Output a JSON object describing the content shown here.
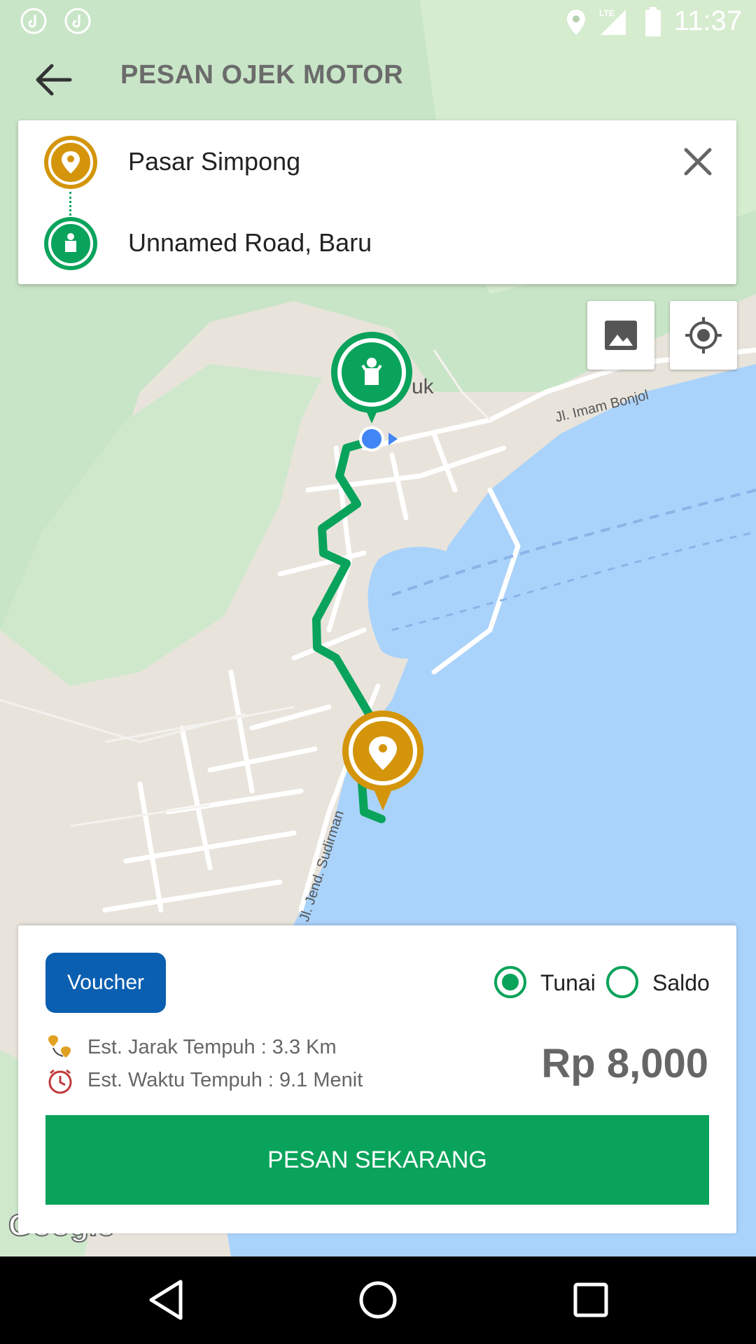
{
  "status_bar": {
    "time": "11:37",
    "network": "LTE"
  },
  "app_bar": {
    "title": "PESAN OJEK MOTOR"
  },
  "route": {
    "origin": "Pasar Simpong",
    "destination": "Unnamed Road, Baru"
  },
  "map": {
    "labels": {
      "poi_fragment": "uk",
      "street_1": "Jl. Imam Bonjol",
      "street_2": "Jl. Jend. Sudirman"
    },
    "attribution": "Google",
    "route_color": "#0aa35b",
    "origin_pin_color": "#d4950a",
    "destination_pin_color": "#0aa35b"
  },
  "booking": {
    "voucher_label": "Voucher",
    "payment_options": [
      {
        "label": "Tunai",
        "selected": true
      },
      {
        "label": "Saldo",
        "selected": false
      }
    ],
    "distance_text": "Est. Jarak Tempuh : 3.3 Km",
    "time_text": "Est. Waktu Tempuh : 9.1 Menit",
    "price": "Rp 8,000",
    "order_button": "PESAN SEKARANG"
  },
  "colors": {
    "primary": "#0aa35b",
    "voucher": "#0a5fb0",
    "water": "#aad3fb"
  }
}
